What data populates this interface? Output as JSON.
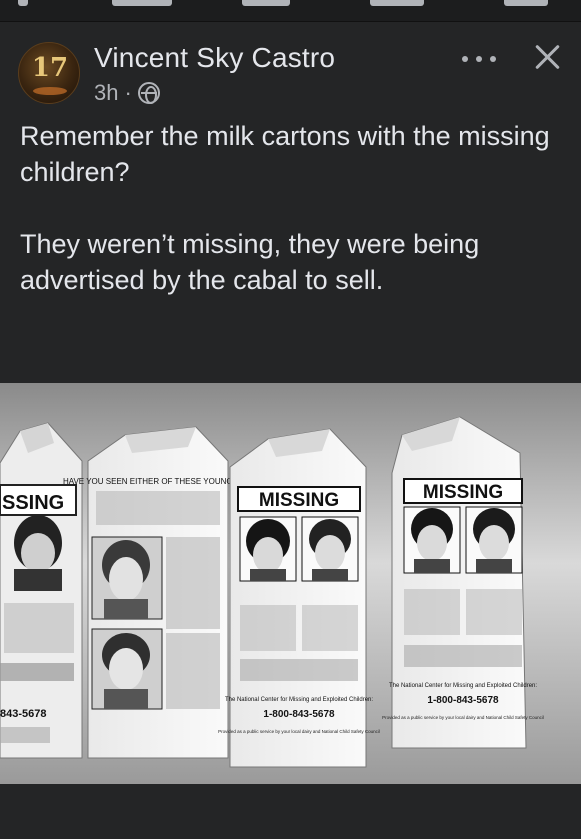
{
  "post": {
    "avatar_badge": "17",
    "author": "Vincent Sky Castro",
    "time": "3h",
    "separator": "·",
    "audience_icon": "globe-icon",
    "text_paragraph_1": "Remember the milk cartons with the missing children?",
    "text_paragraph_2": "They weren’t missing, they were being advertised by the cabal to sell."
  },
  "photo": {
    "cartons": [
      {
        "headline": "SSING"
      },
      {
        "headline": "HAVE YOU SEEN EITHER OF THESE YOUNG MEN?"
      },
      {
        "headline": "MISSING",
        "center": "The National Center for Missing and Exploited Children:",
        "phone": "1-800-843-5678",
        "footer": "Provided as a public service by your local dairy and National Child Safety Council"
      },
      {
        "headline": "MISSING",
        "center": "The National Center for Missing and Exploited Children:",
        "phone": "1-800-843-5678",
        "footer": "Provided as a public service by your local dairy and National Child Safety Council"
      }
    ],
    "left_partial_phone": "843-5678"
  },
  "colors": {
    "background": "#242526",
    "text": "#e4e6eb",
    "secondary_text": "#b0b3b8"
  }
}
